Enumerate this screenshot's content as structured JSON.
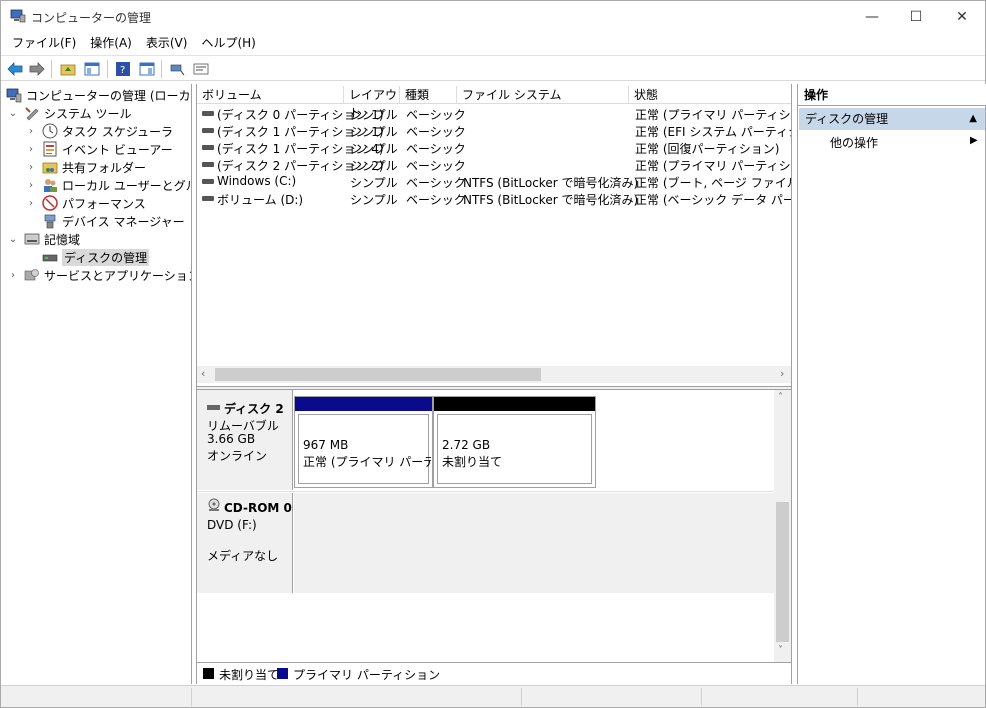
{
  "window": {
    "title": "コンピューターの管理",
    "minimize": "—",
    "maximize": "☐",
    "close": "✕"
  },
  "menu": [
    "ファイル(F)",
    "操作(A)",
    "表示(V)",
    "ヘルプ(H)"
  ],
  "tree": {
    "root": "コンピューターの管理 (ローカル)",
    "system_tools": "システム ツール",
    "task_scheduler": "タスク スケジューラ",
    "event_viewer": "イベント ビューアー",
    "shared_folders": "共有フォルダー",
    "local_users": "ローカル ユーザーとグループ",
    "performance": "パフォーマンス",
    "device_manager": "デバイス マネージャー",
    "storage": "記憶域",
    "disk_management": "ディスクの管理",
    "services": "サービスとアプリケーション"
  },
  "columns": {
    "volume": "ボリューム",
    "layout": "レイアウト",
    "type": "種類",
    "filesystem": "ファイル システム",
    "status": "状態"
  },
  "volumes": [
    {
      "name": "(ディスク 0 パーティション 1)",
      "layout": "シンプル",
      "type": "ベーシック",
      "fs": "",
      "status": "正常 (プライマリ パーティション)"
    },
    {
      "name": "(ディスク 1 パーティション 1)",
      "layout": "シンプル",
      "type": "ベーシック",
      "fs": "",
      "status": "正常 (EFI システム パーティション)"
    },
    {
      "name": "(ディスク 1 パーティション 4)",
      "layout": "シンプル",
      "type": "ベーシック",
      "fs": "",
      "status": "正常 (回復パーティション)"
    },
    {
      "name": "(ディスク 2 パーティション 2)",
      "layout": "シンプル",
      "type": "ベーシック",
      "fs": "",
      "status": "正常 (プライマリ パーティション)"
    },
    {
      "name": "Windows (C:)",
      "layout": "シンプル",
      "type": "ベーシック",
      "fs": "NTFS (BitLocker で暗号化済み)",
      "status": "正常 (ブート, ページ ファイル, クラッ"
    },
    {
      "name": "ボリューム (D:)",
      "layout": "シンプル",
      "type": "ベーシック",
      "fs": "NTFS (BitLocker で暗号化済み)",
      "status": "正常 (ベーシック データ パーティシ"
    }
  ],
  "disks": {
    "disk2": {
      "name": "ディスク 2",
      "kind": "リムーバブル",
      "size": "3.66 GB",
      "state": "オンライン",
      "p1_size": "967 MB",
      "p1_status": "正常 (プライマリ パーティション)",
      "p2_size": "2.72 GB",
      "p2_status": "未割り当て"
    },
    "cdrom0": {
      "name": "CD-ROM 0",
      "kind": "DVD (F:)",
      "state": "メディアなし"
    }
  },
  "legend": {
    "unallocated": "未割り当て",
    "primary": "プライマリ パーティション"
  },
  "actions": {
    "header": "操作",
    "section": "ディスクの管理",
    "more": "他の操作"
  },
  "colors": {
    "primary_partition": "#0a0a8c",
    "unallocated": "#000000",
    "selection": "#c6d7ea"
  }
}
